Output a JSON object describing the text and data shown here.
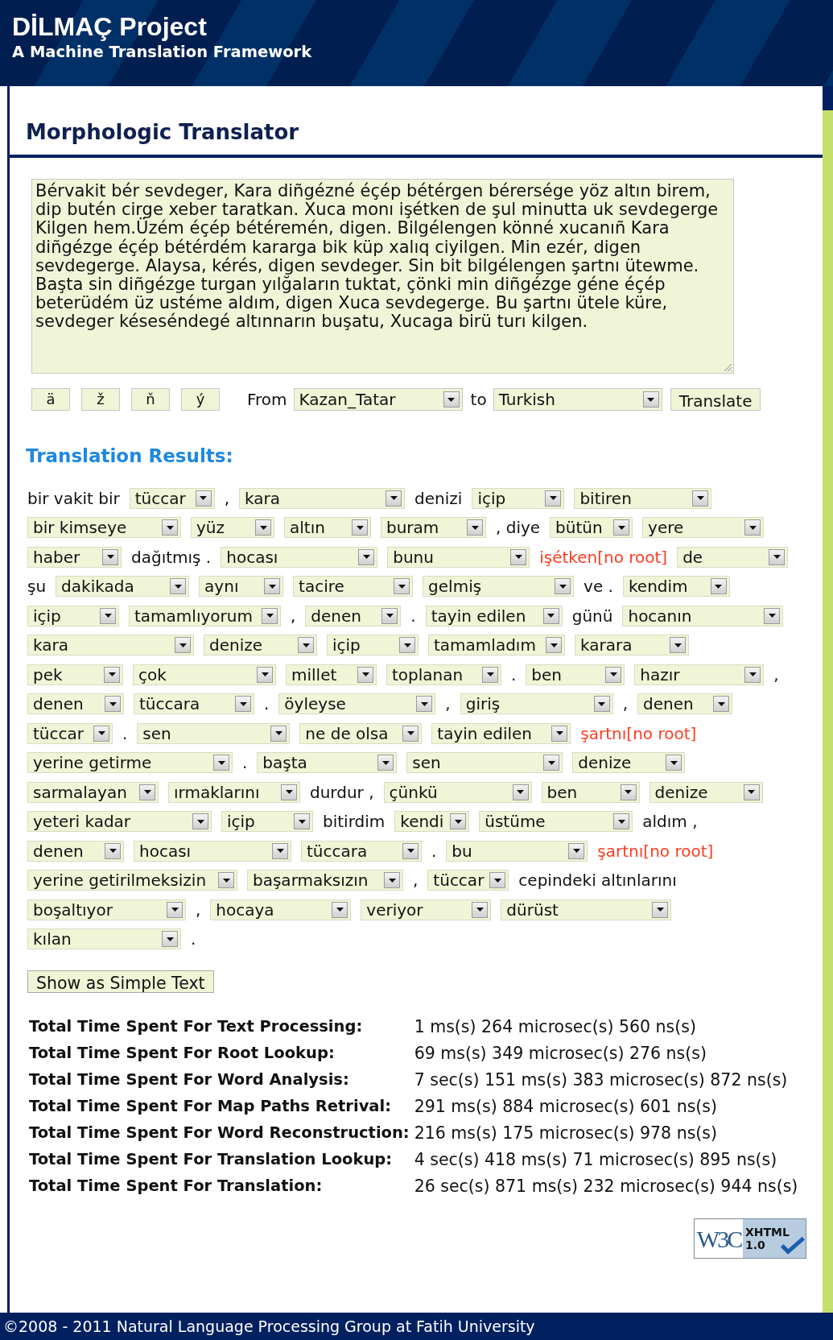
{
  "header": {
    "title": "DİLMAÇ Project",
    "subtitle": "A Machine Translation Framework"
  },
  "page_title": "Morphologic Translator",
  "source_text": {
    "lines": [
      "Bérvakit bér sevdeger, Kara diñgézné éçép bétérgen bérersége yöz altın birem,",
      "dip butén cirge xeber taratkan. Xuca monı işétken de şul minutta uk sevdegerge",
      "Kilgen hem.Üzém éçép bétéremén, digen. Bilgélengen könné xucanıñ Kara",
      "diñgézge éçép bétérdém kararga bik küp xalıq ciyilgen. Min ezér, digen",
      "sevdegerge. Alaysa, kérés, digen sevdeger. Sin bit bilgélengen şartnı ütewme.",
      "Başta sin diñgézge turgan yılğaların tuktat, çönki min diñgézge géne éçép",
      "beterüdém üz ustéme aldım, digen Xuca sevdegerge. Bu şartnı ütele küre,",
      "sevdeger késeséndegé altınnarın buşatu, Xucaga birü turı kilgen."
    ]
  },
  "char_buttons": [
    "ä",
    "ž",
    "ň",
    "ý"
  ],
  "from_label": "From",
  "from_value": "Kazan_Tatar",
  "to_label": "to",
  "to_value": "Turkish",
  "translate_button": "Translate",
  "results_title": "Translation Results:",
  "result_rows": [
    [
      {
        "kind": "text",
        "text": "bir vakit bir"
      },
      {
        "kind": "select",
        "text": "tüccar"
      },
      {
        "kind": "text",
        "text": ","
      },
      {
        "kind": "select",
        "text": "kara"
      },
      {
        "kind": "text",
        "text": "denizi"
      },
      {
        "kind": "select",
        "text": "içip"
      },
      {
        "kind": "select",
        "text": "bitiren"
      }
    ],
    [
      {
        "kind": "select",
        "text": "bir kimseye"
      },
      {
        "kind": "select",
        "text": "yüz"
      },
      {
        "kind": "select",
        "text": "altın"
      },
      {
        "kind": "select",
        "text": "buram"
      },
      {
        "kind": "text",
        "text": ", diye"
      },
      {
        "kind": "select",
        "text": "bütün"
      },
      {
        "kind": "select",
        "text": "yere"
      }
    ],
    [
      {
        "kind": "select",
        "text": "haber"
      },
      {
        "kind": "text",
        "text": "dağıtmış ."
      },
      {
        "kind": "select",
        "text": "hocası"
      },
      {
        "kind": "select",
        "text": "bunu"
      },
      {
        "kind": "error",
        "text": "işétken[no root]"
      },
      {
        "kind": "select",
        "text": "de"
      }
    ],
    [
      {
        "kind": "text",
        "text": "şu"
      },
      {
        "kind": "select",
        "text": "dakikada"
      },
      {
        "kind": "select",
        "text": "aynı"
      },
      {
        "kind": "select",
        "text": "tacire"
      },
      {
        "kind": "select",
        "text": "gelmiş"
      },
      {
        "kind": "text",
        "text": "ve ."
      },
      {
        "kind": "select",
        "text": "kendim"
      }
    ],
    [
      {
        "kind": "select",
        "text": "içip"
      },
      {
        "kind": "select",
        "text": "tamamlıyorum"
      },
      {
        "kind": "text",
        "text": ","
      },
      {
        "kind": "select",
        "text": "denen"
      },
      {
        "kind": "text",
        "text": "."
      },
      {
        "kind": "select",
        "text": "tayin edilen"
      },
      {
        "kind": "text",
        "text": "günü"
      },
      {
        "kind": "select",
        "text": "hocanın"
      }
    ],
    [
      {
        "kind": "select",
        "text": "kara"
      },
      {
        "kind": "select",
        "text": "denize"
      },
      {
        "kind": "select",
        "text": "içip"
      },
      {
        "kind": "select",
        "text": "tamamladım"
      },
      {
        "kind": "select",
        "text": "karara"
      }
    ],
    [
      {
        "kind": "select",
        "text": "pek"
      },
      {
        "kind": "select",
        "text": "çok"
      },
      {
        "kind": "select",
        "text": "millet"
      },
      {
        "kind": "select",
        "text": "toplanan"
      },
      {
        "kind": "text",
        "text": "."
      },
      {
        "kind": "select",
        "text": "ben"
      },
      {
        "kind": "select",
        "text": "hazır"
      },
      {
        "kind": "text",
        "text": ","
      }
    ],
    [
      {
        "kind": "select",
        "text": "denen"
      },
      {
        "kind": "select",
        "text": "tüccara"
      },
      {
        "kind": "text",
        "text": "."
      },
      {
        "kind": "select",
        "text": "öyleyse"
      },
      {
        "kind": "text",
        "text": ","
      },
      {
        "kind": "select",
        "text": "giriş"
      },
      {
        "kind": "text",
        "text": ","
      },
      {
        "kind": "select",
        "text": "denen"
      }
    ],
    [
      {
        "kind": "select",
        "text": "tüccar"
      },
      {
        "kind": "text",
        "text": "."
      },
      {
        "kind": "select",
        "text": "sen"
      },
      {
        "kind": "select",
        "text": "ne de olsa"
      },
      {
        "kind": "select",
        "text": "tayin edilen"
      },
      {
        "kind": "error",
        "text": "şartnı[no root]"
      }
    ],
    [
      {
        "kind": "select",
        "text": "yerine getirme"
      },
      {
        "kind": "text",
        "text": "."
      },
      {
        "kind": "select",
        "text": "başta"
      },
      {
        "kind": "select",
        "text": "sen"
      },
      {
        "kind": "select",
        "text": "denize"
      }
    ],
    [
      {
        "kind": "select",
        "text": "sarmalayan"
      },
      {
        "kind": "select",
        "text": "ırmaklarını"
      },
      {
        "kind": "text",
        "text": "durdur ,"
      },
      {
        "kind": "select",
        "text": "çünkü"
      },
      {
        "kind": "select",
        "text": "ben"
      },
      {
        "kind": "select",
        "text": "denize"
      }
    ],
    [
      {
        "kind": "select",
        "text": "yeteri kadar"
      },
      {
        "kind": "select",
        "text": "içip"
      },
      {
        "kind": "text",
        "text": "bitirdim"
      },
      {
        "kind": "select",
        "text": "kendi"
      },
      {
        "kind": "select",
        "text": "üstüme"
      },
      {
        "kind": "text",
        "text": "aldım ,"
      }
    ],
    [
      {
        "kind": "select",
        "text": "denen"
      },
      {
        "kind": "select",
        "text": "hocası"
      },
      {
        "kind": "select",
        "text": "tüccara"
      },
      {
        "kind": "text",
        "text": "."
      },
      {
        "kind": "select",
        "text": "bu"
      },
      {
        "kind": "error",
        "text": "şartnı[no root]"
      }
    ],
    [
      {
        "kind": "select",
        "text": "yerine getirilmeksizin"
      },
      {
        "kind": "select",
        "text": "başarmaksızın"
      },
      {
        "kind": "text",
        "text": ","
      },
      {
        "kind": "select",
        "text": "tüccar"
      },
      {
        "kind": "text",
        "text": "cepindeki altınlarını"
      }
    ],
    [
      {
        "kind": "select",
        "text": "boşaltıyor"
      },
      {
        "kind": "text",
        "text": ","
      },
      {
        "kind": "select",
        "text": "hocaya"
      },
      {
        "kind": "select",
        "text": "veriyor"
      },
      {
        "kind": "select",
        "text": "dürüst"
      }
    ],
    [
      {
        "kind": "select",
        "text": "kılan"
      },
      {
        "kind": "text",
        "text": "."
      }
    ]
  ],
  "simple_text_button": "Show as Simple Text",
  "timings": [
    {
      "label": "Total Time Spent For Text Processing:",
      "value": "1 ms(s) 264 microsec(s) 560 ns(s)"
    },
    {
      "label": "Total Time Spent For Root Lookup:",
      "value": "69 ms(s) 349 microsec(s) 276 ns(s)"
    },
    {
      "label": "Total Time Spent For Word Analysis:",
      "value": "7 sec(s) 151 ms(s) 383 microsec(s) 872 ns(s)"
    },
    {
      "label": "Total Time Spent For Map Paths Retrival:",
      "value": "291 ms(s) 884 microsec(s) 601 ns(s)"
    },
    {
      "label": "Total Time Spent For Word Reconstruction:",
      "value": "216 ms(s) 175 microsec(s) 978 ns(s)"
    },
    {
      "label": "Total Time Spent For Translation Lookup:",
      "value": "4 sec(s) 418 ms(s) 71 microsec(s) 895 ns(s)"
    },
    {
      "label": "Total Time Spent For Translation:",
      "value": "26 sec(s) 871 ms(s) 232 microsec(s) 944 ns(s)"
    }
  ],
  "badge": {
    "logo": "W3C",
    "name": "XHTML",
    "version": "1.0"
  },
  "footer": "©2008 - 2011 Natural Language Processing Group at Fatih University"
}
